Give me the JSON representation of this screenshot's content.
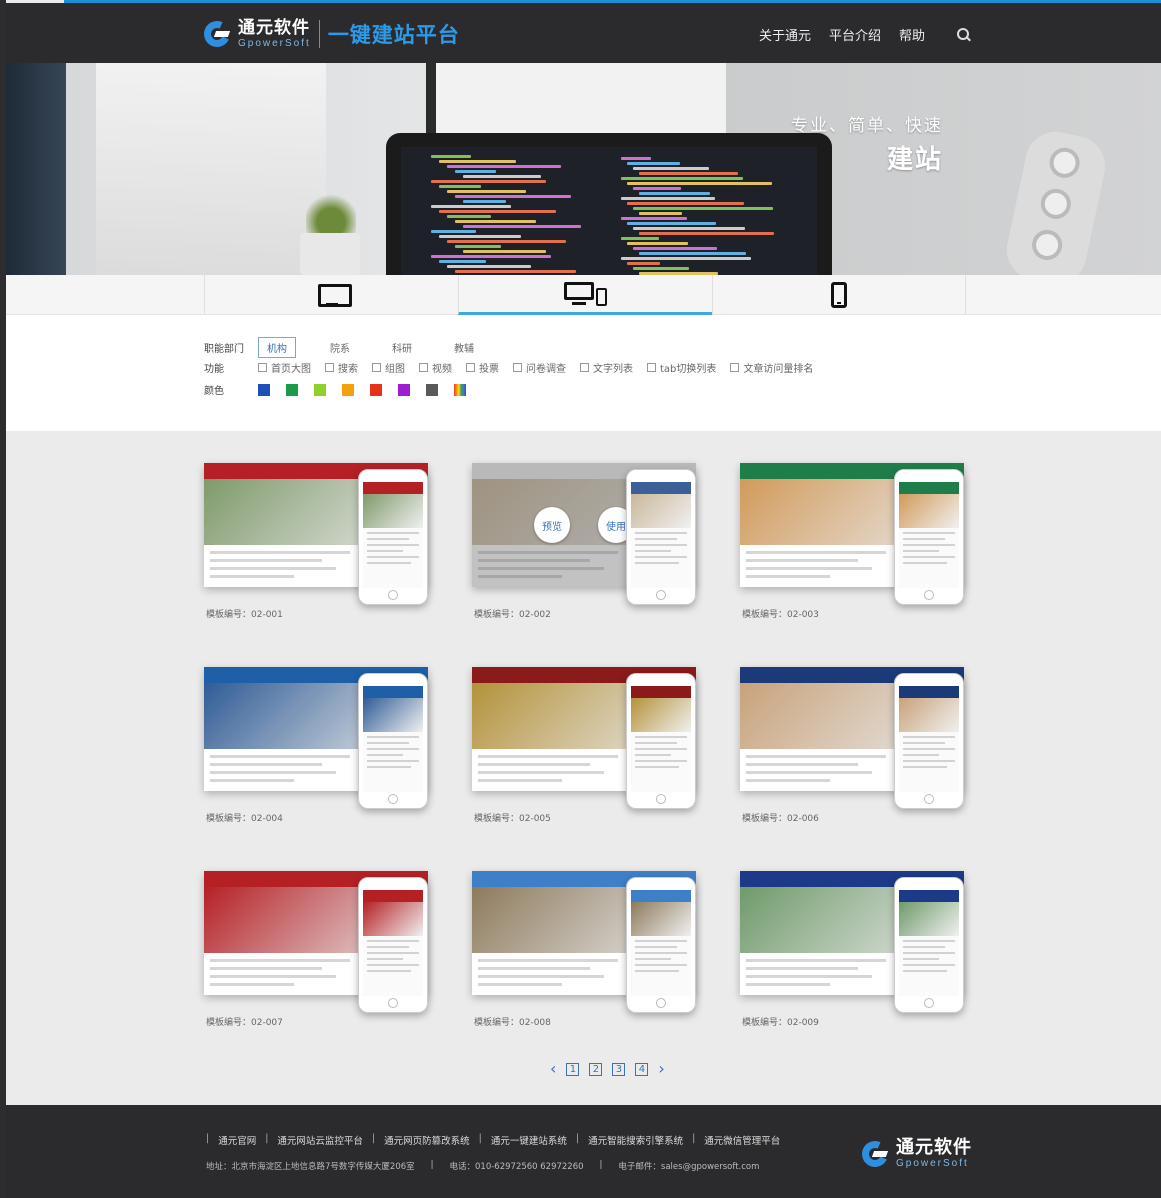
{
  "header": {
    "logo_cn": "通元软件",
    "logo_en": "GpowerSoft",
    "slogan": "一键建站平台",
    "nav": [
      "关于通元",
      "平台介绍",
      "帮助"
    ]
  },
  "hero": {
    "subtitle": "专业、简单、快速",
    "title": "建站"
  },
  "device_tabs": [
    "desktop",
    "multi-device",
    "mobile"
  ],
  "filters": {
    "dept_label": "职能部门",
    "dept_options": [
      "机构",
      "院系",
      "科研",
      "教辅"
    ],
    "dept_selected": "机构",
    "func_label": "功能",
    "func_options": [
      "首页大图",
      "搜索",
      "组图",
      "视频",
      "投票",
      "问卷调查",
      "文字列表",
      "tab切换列表",
      "文章访问量排名"
    ],
    "color_label": "颜色",
    "colors": [
      "#1e4fb4",
      "#1b9a4a",
      "#8fd12a",
      "#f2a20c",
      "#e6321c",
      "#9b1fd0",
      "#5a5a5a",
      "rainbow"
    ]
  },
  "templates": [
    {
      "caption": "模板编号：02-001",
      "bar": "#b52025",
      "img": "#7f9a6a",
      "pbar": "#b52025"
    },
    {
      "caption": "模板编号：02-002",
      "bar": "#f2f2f2",
      "img": "#c9b79a",
      "pbar": "#3d5f98",
      "overlay": [
        "预览",
        "使用"
      ]
    },
    {
      "caption": "模板编号：02-003",
      "bar": "#1f7d4a",
      "img": "#d29a5a",
      "pbar": "#1f7d4a"
    },
    {
      "caption": "模板编号：02-004",
      "bar": "#1e5fa8",
      "img": "#2f5c96",
      "pbar": "#1e5fa8"
    },
    {
      "caption": "模板编号：02-005",
      "bar": "#8b1a1a",
      "img": "#b4923a",
      "pbar": "#8b1a1a"
    },
    {
      "caption": "模板编号：02-006",
      "bar": "#1c3a78",
      "img": "#c8a27a",
      "pbar": "#1c3a78"
    },
    {
      "caption": "模板编号：02-007",
      "bar": "#b52025",
      "img": "#b52025",
      "pbar": "#b52025"
    },
    {
      "caption": "模板编号：02-008",
      "bar": "#3f7fc8",
      "img": "#8d7a5c",
      "pbar": "#3f7fc8"
    },
    {
      "caption": "模板编号：02-009",
      "bar": "#1c3a88",
      "img": "#6f9a6a",
      "pbar": "#1c3a88"
    }
  ],
  "pager": [
    "1",
    "2",
    "3",
    "4"
  ],
  "footer": {
    "links": [
      "通元官网",
      "通元网站云监控平台",
      "通元网页防篡改系统",
      "通元一键建站系统",
      "通元智能搜索引擎系统",
      "通元微信管理平台"
    ],
    "address": "地址：北京市海淀区上地信息路7号数字传媒大厦206室",
    "phone": "电话：010-62972560 62972260",
    "email": "电子邮件：sales@gpowersoft.com"
  }
}
